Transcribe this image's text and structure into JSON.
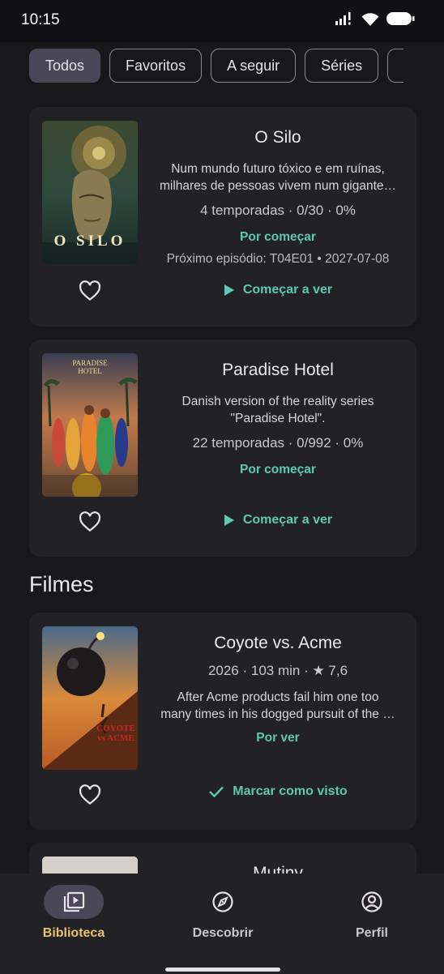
{
  "status_bar": {
    "time": "10:15",
    "icons": [
      "signal-icon",
      "wifi-icon",
      "battery-icon"
    ]
  },
  "filters": {
    "chips": [
      {
        "label": "Todos",
        "selected": true
      },
      {
        "label": "Favoritos",
        "selected": false
      },
      {
        "label": "A seguir",
        "selected": false
      },
      {
        "label": "Séries",
        "selected": false
      }
    ]
  },
  "series": [
    {
      "title": "O Silo",
      "poster_text": "O SILO",
      "description_line1": "Num mundo futuro tóxico e em ruínas,",
      "description_line2": "milhares de pessoas vivem num gigante…",
      "stats": "4 temporadas · 0/30 · 0%",
      "status": "Por começar",
      "next_episode": "Próximo episódio: T04E01 • 2027-07-08",
      "action": "Começar a ver",
      "action_icon": "play-icon",
      "favorite": false
    },
    {
      "title": "Paradise Hotel",
      "poster_text": "PARADISE HOTEL",
      "description_line1": "Danish version of the reality series",
      "description_line2": "\"Paradise Hotel\".",
      "stats": "22 temporadas · 0/992 · 0%",
      "status": "Por começar",
      "action": "Começar a ver",
      "action_icon": "play-icon",
      "favorite": false
    }
  ],
  "movies_section": {
    "title": "Filmes",
    "items": [
      {
        "title": "Coyote vs. Acme",
        "poster_text": "COYOTE vs ACME",
        "meta": "2026 · 103 min · ★ 7,6",
        "description_line1": "After Acme products fail him one too",
        "description_line2": "many times in his dogged pursuit of the …",
        "status": "Por ver",
        "action": "Marcar como visto",
        "action_icon": "check-icon",
        "favorite": false
      },
      {
        "title": "Mutiny"
      }
    ]
  },
  "bottom_nav": {
    "items": [
      {
        "label": "Biblioteca",
        "icon": "library-icon",
        "active": true
      },
      {
        "label": "Descobrir",
        "icon": "compass-icon",
        "active": false
      },
      {
        "label": "Perfil",
        "icon": "profile-icon",
        "active": false
      }
    ]
  },
  "colors": {
    "accent_teal": "#5ec8b4",
    "active_nav": "#e8c36a",
    "selected_chip": "#4a4756",
    "card_bg": "#222226"
  }
}
